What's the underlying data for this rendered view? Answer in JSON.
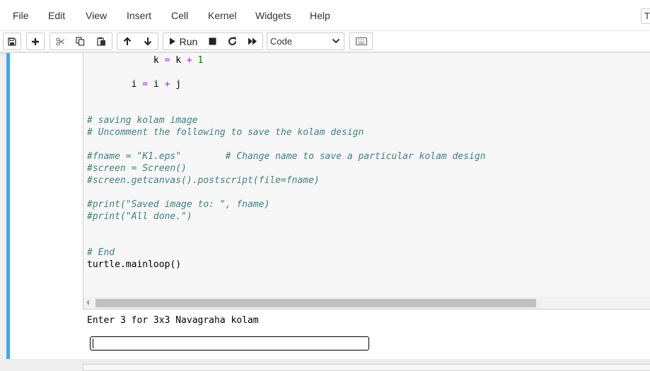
{
  "menubar": {
    "items": [
      "File",
      "Edit",
      "View",
      "Insert",
      "Cell",
      "Kernel",
      "Widgets",
      "Help"
    ],
    "kernel_indicator": "T"
  },
  "toolbar": {
    "icons": [
      "save-icon",
      "plus-icon",
      "scissors-icon",
      "copy-icon",
      "paste-icon",
      "arrow-up-icon",
      "arrow-down-icon",
      "play-icon",
      "stop-icon",
      "restart-icon",
      "fast-forward-icon",
      "keyboard-icon"
    ],
    "run_label": "Run",
    "cell_type": "Code"
  },
  "code_cell": {
    "lines": [
      {
        "indent": "            ",
        "tokens": [
          {
            "t": "k",
            "c": "plain"
          },
          {
            "t": " = ",
            "c": "op"
          },
          {
            "t": "k",
            "c": "plain"
          },
          {
            "t": " + ",
            "c": "op"
          },
          {
            "t": "1",
            "c": "num"
          }
        ]
      },
      {
        "indent": "",
        "tokens": []
      },
      {
        "indent": "        ",
        "tokens": [
          {
            "t": "i",
            "c": "plain"
          },
          {
            "t": " = ",
            "c": "op"
          },
          {
            "t": "i",
            "c": "plain"
          },
          {
            "t": " + ",
            "c": "op"
          },
          {
            "t": "j",
            "c": "plain"
          }
        ]
      },
      {
        "indent": "",
        "tokens": []
      },
      {
        "indent": "",
        "tokens": []
      },
      {
        "indent": "",
        "tokens": [
          {
            "t": "# saving kolam image",
            "c": "comment"
          }
        ]
      },
      {
        "indent": "",
        "tokens": [
          {
            "t": "# Uncomment the following to save the kolam design",
            "c": "comment"
          }
        ]
      },
      {
        "indent": "",
        "tokens": []
      },
      {
        "indent": "",
        "tokens": [
          {
            "t": "#fname = \"K1.eps\"        # Change name to save a particular kolam design",
            "c": "comment"
          }
        ]
      },
      {
        "indent": "",
        "tokens": [
          {
            "t": "#screen = Screen()",
            "c": "comment"
          }
        ]
      },
      {
        "indent": "",
        "tokens": [
          {
            "t": "#screen.getcanvas().postscript(file=fname)",
            "c": "comment"
          }
        ]
      },
      {
        "indent": "",
        "tokens": []
      },
      {
        "indent": "",
        "tokens": [
          {
            "t": "#print(\"Saved image to: \", fname)",
            "c": "comment"
          }
        ]
      },
      {
        "indent": "",
        "tokens": [
          {
            "t": "#print(\"All done.\")",
            "c": "comment"
          }
        ]
      },
      {
        "indent": "",
        "tokens": []
      },
      {
        "indent": "",
        "tokens": []
      },
      {
        "indent": "",
        "tokens": [
          {
            "t": "# End",
            "c": "comment"
          }
        ]
      },
      {
        "indent": "",
        "tokens": [
          {
            "t": "turtle.mainloop()",
            "c": "plain"
          }
        ]
      }
    ]
  },
  "output": {
    "text": "Enter 3 for 3x3 Navagraha kolam",
    "input_value": ""
  }
}
